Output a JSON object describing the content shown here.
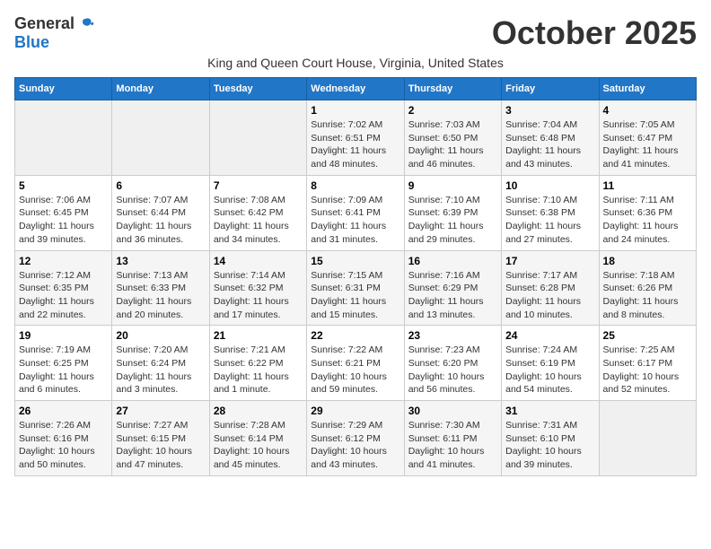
{
  "header": {
    "logo_general": "General",
    "logo_blue": "Blue",
    "month_title": "October 2025",
    "subtitle": "King and Queen Court House, Virginia, United States"
  },
  "weekdays": [
    "Sunday",
    "Monday",
    "Tuesday",
    "Wednesday",
    "Thursday",
    "Friday",
    "Saturday"
  ],
  "weeks": [
    [
      {
        "day": "",
        "info": ""
      },
      {
        "day": "",
        "info": ""
      },
      {
        "day": "",
        "info": ""
      },
      {
        "day": "1",
        "info": "Sunrise: 7:02 AM\nSunset: 6:51 PM\nDaylight: 11 hours\nand 48 minutes."
      },
      {
        "day": "2",
        "info": "Sunrise: 7:03 AM\nSunset: 6:50 PM\nDaylight: 11 hours\nand 46 minutes."
      },
      {
        "day": "3",
        "info": "Sunrise: 7:04 AM\nSunset: 6:48 PM\nDaylight: 11 hours\nand 43 minutes."
      },
      {
        "day": "4",
        "info": "Sunrise: 7:05 AM\nSunset: 6:47 PM\nDaylight: 11 hours\nand 41 minutes."
      }
    ],
    [
      {
        "day": "5",
        "info": "Sunrise: 7:06 AM\nSunset: 6:45 PM\nDaylight: 11 hours\nand 39 minutes."
      },
      {
        "day": "6",
        "info": "Sunrise: 7:07 AM\nSunset: 6:44 PM\nDaylight: 11 hours\nand 36 minutes."
      },
      {
        "day": "7",
        "info": "Sunrise: 7:08 AM\nSunset: 6:42 PM\nDaylight: 11 hours\nand 34 minutes."
      },
      {
        "day": "8",
        "info": "Sunrise: 7:09 AM\nSunset: 6:41 PM\nDaylight: 11 hours\nand 31 minutes."
      },
      {
        "day": "9",
        "info": "Sunrise: 7:10 AM\nSunset: 6:39 PM\nDaylight: 11 hours\nand 29 minutes."
      },
      {
        "day": "10",
        "info": "Sunrise: 7:10 AM\nSunset: 6:38 PM\nDaylight: 11 hours\nand 27 minutes."
      },
      {
        "day": "11",
        "info": "Sunrise: 7:11 AM\nSunset: 6:36 PM\nDaylight: 11 hours\nand 24 minutes."
      }
    ],
    [
      {
        "day": "12",
        "info": "Sunrise: 7:12 AM\nSunset: 6:35 PM\nDaylight: 11 hours\nand 22 minutes."
      },
      {
        "day": "13",
        "info": "Sunrise: 7:13 AM\nSunset: 6:33 PM\nDaylight: 11 hours\nand 20 minutes."
      },
      {
        "day": "14",
        "info": "Sunrise: 7:14 AM\nSunset: 6:32 PM\nDaylight: 11 hours\nand 17 minutes."
      },
      {
        "day": "15",
        "info": "Sunrise: 7:15 AM\nSunset: 6:31 PM\nDaylight: 11 hours\nand 15 minutes."
      },
      {
        "day": "16",
        "info": "Sunrise: 7:16 AM\nSunset: 6:29 PM\nDaylight: 11 hours\nand 13 minutes."
      },
      {
        "day": "17",
        "info": "Sunrise: 7:17 AM\nSunset: 6:28 PM\nDaylight: 11 hours\nand 10 minutes."
      },
      {
        "day": "18",
        "info": "Sunrise: 7:18 AM\nSunset: 6:26 PM\nDaylight: 11 hours\nand 8 minutes."
      }
    ],
    [
      {
        "day": "19",
        "info": "Sunrise: 7:19 AM\nSunset: 6:25 PM\nDaylight: 11 hours\nand 6 minutes."
      },
      {
        "day": "20",
        "info": "Sunrise: 7:20 AM\nSunset: 6:24 PM\nDaylight: 11 hours\nand 3 minutes."
      },
      {
        "day": "21",
        "info": "Sunrise: 7:21 AM\nSunset: 6:22 PM\nDaylight: 11 hours\nand 1 minute."
      },
      {
        "day": "22",
        "info": "Sunrise: 7:22 AM\nSunset: 6:21 PM\nDaylight: 10 hours\nand 59 minutes."
      },
      {
        "day": "23",
        "info": "Sunrise: 7:23 AM\nSunset: 6:20 PM\nDaylight: 10 hours\nand 56 minutes."
      },
      {
        "day": "24",
        "info": "Sunrise: 7:24 AM\nSunset: 6:19 PM\nDaylight: 10 hours\nand 54 minutes."
      },
      {
        "day": "25",
        "info": "Sunrise: 7:25 AM\nSunset: 6:17 PM\nDaylight: 10 hours\nand 52 minutes."
      }
    ],
    [
      {
        "day": "26",
        "info": "Sunrise: 7:26 AM\nSunset: 6:16 PM\nDaylight: 10 hours\nand 50 minutes."
      },
      {
        "day": "27",
        "info": "Sunrise: 7:27 AM\nSunset: 6:15 PM\nDaylight: 10 hours\nand 47 minutes."
      },
      {
        "day": "28",
        "info": "Sunrise: 7:28 AM\nSunset: 6:14 PM\nDaylight: 10 hours\nand 45 minutes."
      },
      {
        "day": "29",
        "info": "Sunrise: 7:29 AM\nSunset: 6:12 PM\nDaylight: 10 hours\nand 43 minutes."
      },
      {
        "day": "30",
        "info": "Sunrise: 7:30 AM\nSunset: 6:11 PM\nDaylight: 10 hours\nand 41 minutes."
      },
      {
        "day": "31",
        "info": "Sunrise: 7:31 AM\nSunset: 6:10 PM\nDaylight: 10 hours\nand 39 minutes."
      },
      {
        "day": "",
        "info": ""
      }
    ]
  ]
}
